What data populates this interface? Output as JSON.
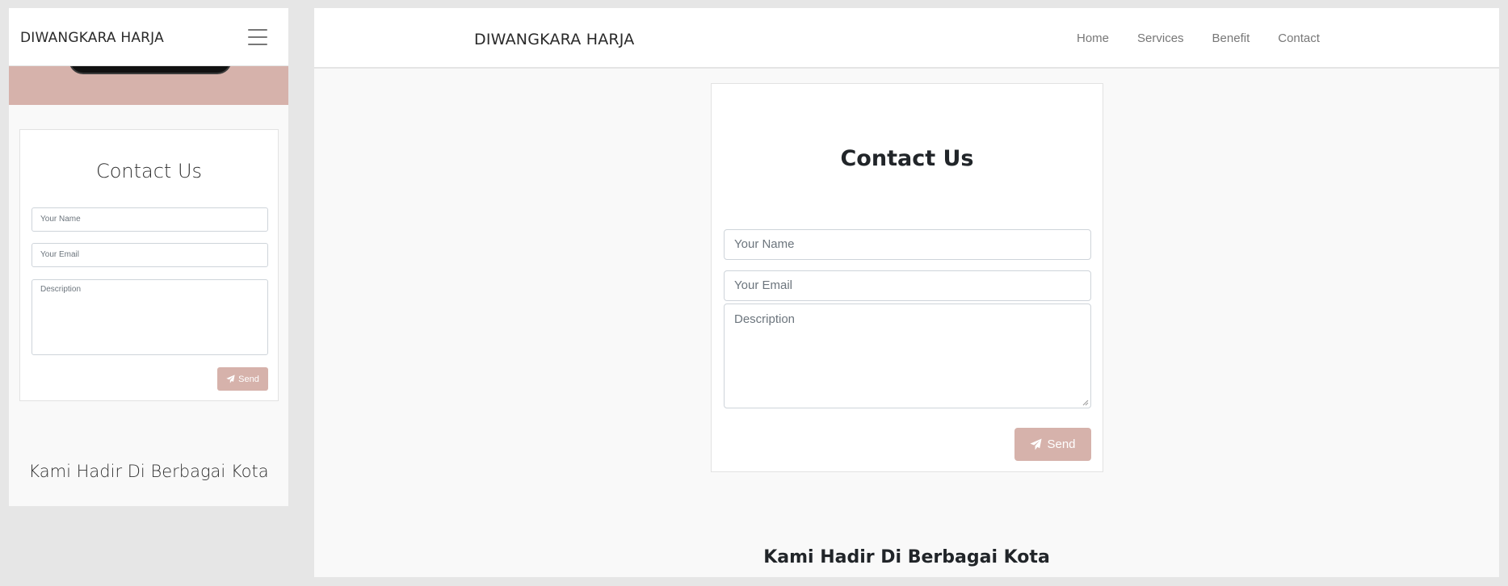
{
  "brand": "DIWANGKARA HARJA",
  "nav": {
    "links": [
      "Home",
      "Services",
      "Benefit",
      "Contact"
    ]
  },
  "contact": {
    "title": "Contact Us",
    "name_placeholder": "Your Name",
    "email_placeholder": "Your Email",
    "description_placeholder": "Description",
    "send_label": "Send"
  },
  "cities_heading": "Kami Hadir Di Berbagai Kota",
  "icons": {
    "menu": "hamburger-menu-icon",
    "send": "paper-plane-icon"
  },
  "colors": {
    "accent": "#d6b2ab",
    "page_bg": "#f9f9f9",
    "nav_text": "#777777"
  }
}
